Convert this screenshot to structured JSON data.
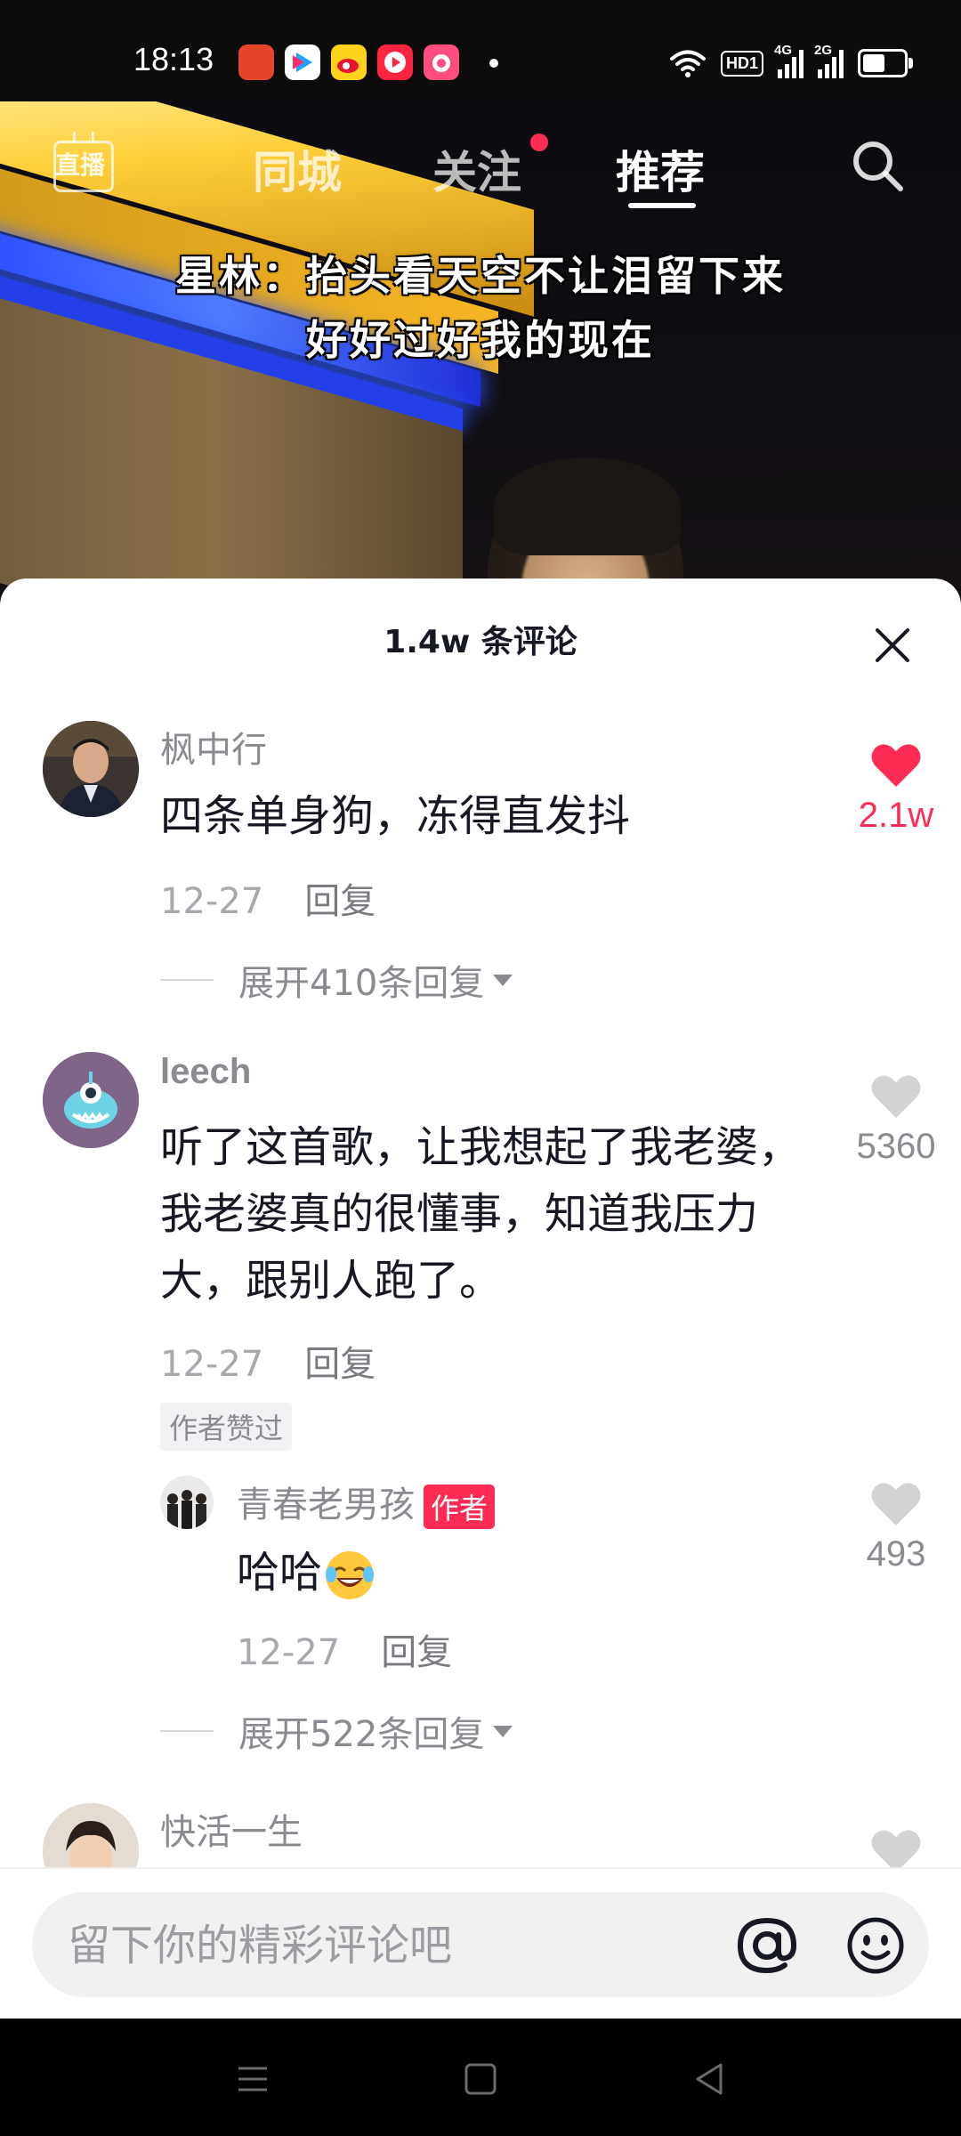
{
  "status_bar": {
    "time": "18:13",
    "apps": [
      "weibo-ecommerce-icon",
      "youku-icon",
      "weibo-icon",
      "video-app-icon",
      "camera-app-icon"
    ],
    "hd_label": "HD1",
    "network_1": "4G",
    "network_2": "2G",
    "battery_level": 0.55
  },
  "video": {
    "caption_line1": "星林：抬头看天空不让泪留下来",
    "caption_line2": "好好过好我的现在"
  },
  "top_nav": {
    "live_label": "直播",
    "tabs": [
      {
        "label": "同城",
        "active": false
      },
      {
        "label": "关注",
        "active": false,
        "has_dot": true
      },
      {
        "label": "推荐",
        "active": true
      }
    ]
  },
  "comments_panel": {
    "title": "1.4w 条评论",
    "comments": [
      {
        "name": "枫中行",
        "text": "四条单身狗，冻得直发抖",
        "date": "12-27",
        "reply_label": "回复",
        "likes": "2.1w",
        "liked": true,
        "expand_label": "展开410条回复"
      },
      {
        "name": "leech",
        "text": "听了这首歌，让我想起了我老婆，我老婆真的很懂事，知道我压力大，跟别人跑了。",
        "date": "12-27",
        "reply_label": "回复",
        "likes": "5360",
        "liked": false,
        "author_liked_tag": "作者赞过",
        "reply": {
          "name": "青春老男孩",
          "badge": "作者",
          "text": "哈哈",
          "date": "12-27",
          "reply_label": "回复",
          "likes": "493"
        },
        "expand_label": "展开522条回复"
      },
      {
        "name": "快活一生"
      }
    ]
  },
  "input": {
    "placeholder": "留下你的精彩评论吧"
  },
  "colors": {
    "accent": "#fe2c55",
    "text": "#161823",
    "secondary": "#8a8b91"
  }
}
